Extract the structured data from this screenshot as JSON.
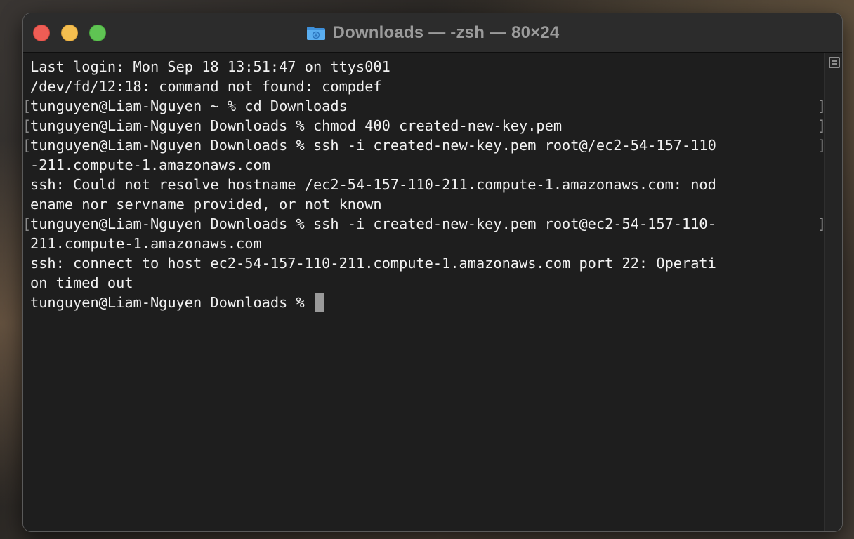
{
  "window": {
    "title": "Downloads — -zsh — 80×24",
    "folder_icon": "folder-icon"
  },
  "terminal": {
    "lines": [
      {
        "text": "Last login: Mon Sep 18 13:51:47 on ttys001",
        "left_bracket": "",
        "right_bracket": ""
      },
      {
        "text": "/dev/fd/12:18: command not found: compdef",
        "left_bracket": "",
        "right_bracket": ""
      },
      {
        "text": "tunguyen@Liam-Nguyen ~ % cd Downloads",
        "left_bracket": "[",
        "right_bracket": "]"
      },
      {
        "text": "tunguyen@Liam-Nguyen Downloads % chmod 400 created-new-key.pem",
        "left_bracket": "[",
        "right_bracket": "]"
      },
      {
        "text": "tunguyen@Liam-Nguyen Downloads % ssh -i created-new-key.pem root@/ec2-54-157-110",
        "left_bracket": "[",
        "right_bracket": "]"
      },
      {
        "text": "-211.compute-1.amazonaws.com",
        "left_bracket": "",
        "right_bracket": ""
      },
      {
        "text": "ssh: Could not resolve hostname /ec2-54-157-110-211.compute-1.amazonaws.com: nod",
        "left_bracket": "",
        "right_bracket": ""
      },
      {
        "text": "ename nor servname provided, or not known",
        "left_bracket": "",
        "right_bracket": ""
      },
      {
        "text": "tunguyen@Liam-Nguyen Downloads % ssh -i created-new-key.pem root@ec2-54-157-110-",
        "left_bracket": "[",
        "right_bracket": "]"
      },
      {
        "text": "211.compute-1.amazonaws.com",
        "left_bracket": "",
        "right_bracket": ""
      },
      {
        "text": "ssh: connect to host ec2-54-157-110-211.compute-1.amazonaws.com port 22: Operati",
        "left_bracket": "",
        "right_bracket": ""
      },
      {
        "text": "on timed out",
        "left_bracket": "",
        "right_bracket": ""
      }
    ],
    "prompt": "tunguyen@Liam-Nguyen Downloads % "
  },
  "colors": {
    "close": "#ee5d55",
    "minimize": "#f4be4f",
    "zoom": "#5fc453",
    "terminal_bg": "#1e1e1e",
    "terminal_fg": "#f2f2f2"
  }
}
